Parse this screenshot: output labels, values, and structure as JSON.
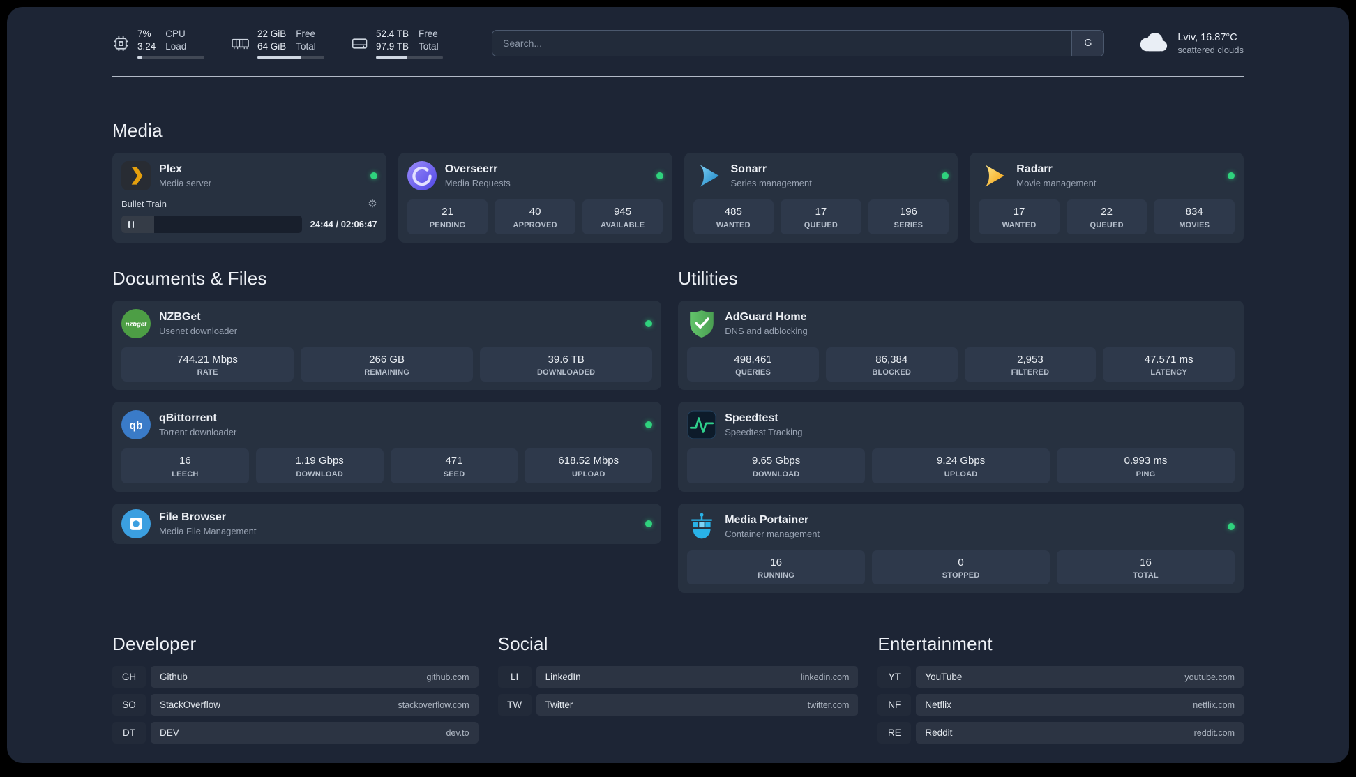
{
  "topbar": {
    "cpu": {
      "percent": "7%",
      "load": "3.24",
      "label_top": "CPU",
      "label_bottom": "Load"
    },
    "memory": {
      "free": "22 GiB",
      "total": "64 GiB",
      "label_top": "Free",
      "label_bottom": "Total"
    },
    "disk": {
      "free": "52.4 TB",
      "total": "97.9 TB",
      "label_top": "Free",
      "label_bottom": "Total"
    },
    "search": {
      "placeholder": "Search...",
      "provider_label": "G"
    },
    "weather": {
      "location": "Lviv, 16.87°C",
      "condition": "scattered clouds"
    }
  },
  "sections": {
    "media": {
      "title": "Media",
      "services": [
        {
          "name": "Plex",
          "desc": "Media server",
          "status": "online",
          "player": {
            "track": "Bullet Train",
            "time": "24:44 / 02:06:47"
          }
        },
        {
          "name": "Overseerr",
          "desc": "Media Requests",
          "status": "online",
          "stats": [
            {
              "value": "21",
              "label": "PENDING"
            },
            {
              "value": "40",
              "label": "APPROVED"
            },
            {
              "value": "945",
              "label": "AVAILABLE"
            }
          ]
        },
        {
          "name": "Sonarr",
          "desc": "Series management",
          "status": "online",
          "stats": [
            {
              "value": "485",
              "label": "WANTED"
            },
            {
              "value": "17",
              "label": "QUEUED"
            },
            {
              "value": "196",
              "label": "SERIES"
            }
          ]
        },
        {
          "name": "Radarr",
          "desc": "Movie management",
          "status": "online",
          "stats": [
            {
              "value": "17",
              "label": "WANTED"
            },
            {
              "value": "22",
              "label": "QUEUED"
            },
            {
              "value": "834",
              "label": "MOVIES"
            }
          ]
        }
      ]
    },
    "documents": {
      "title": "Documents & Files",
      "services": [
        {
          "name": "NZBGet",
          "desc": "Usenet downloader",
          "status": "online",
          "stats": [
            {
              "value": "744.21 Mbps",
              "label": "RATE"
            },
            {
              "value": "266 GB",
              "label": "REMAINING"
            },
            {
              "value": "39.6 TB",
              "label": "DOWNLOADED"
            }
          ]
        },
        {
          "name": "qBittorrent",
          "desc": "Torrent downloader",
          "status": "online",
          "stats": [
            {
              "value": "16",
              "label": "LEECH"
            },
            {
              "value": "1.19 Gbps",
              "label": "DOWNLOAD"
            },
            {
              "value": "471",
              "label": "SEED"
            },
            {
              "value": "618.52 Mbps",
              "label": "UPLOAD"
            }
          ]
        },
        {
          "name": "File Browser",
          "desc": "Media File Management",
          "status": "online"
        }
      ]
    },
    "utilities": {
      "title": "Utilities",
      "services": [
        {
          "name": "AdGuard Home",
          "desc": "DNS and adblocking",
          "stats": [
            {
              "value": "498,461",
              "label": "QUERIES"
            },
            {
              "value": "86,384",
              "label": "BLOCKED"
            },
            {
              "value": "2,953",
              "label": "FILTERED"
            },
            {
              "value": "47.571 ms",
              "label": "LATENCY"
            }
          ]
        },
        {
          "name": "Speedtest",
          "desc": "Speedtest Tracking",
          "stats": [
            {
              "value": "9.65 Gbps",
              "label": "DOWNLOAD"
            },
            {
              "value": "9.24 Gbps",
              "label": "UPLOAD"
            },
            {
              "value": "0.993 ms",
              "label": "PING"
            }
          ]
        },
        {
          "name": "Media Portainer",
          "desc": "Container management",
          "status": "online",
          "stats": [
            {
              "value": "16",
              "label": "RUNNING"
            },
            {
              "value": "0",
              "label": "STOPPED"
            },
            {
              "value": "16",
              "label": "TOTAL"
            }
          ]
        }
      ]
    }
  },
  "bookmark_groups": [
    {
      "title": "Developer",
      "items": [
        {
          "abbr": "GH",
          "name": "Github",
          "url": "github.com"
        },
        {
          "abbr": "SO",
          "name": "StackOverflow",
          "url": "stackoverflow.com"
        },
        {
          "abbr": "DT",
          "name": "DEV",
          "url": "dev.to"
        }
      ]
    },
    {
      "title": "Social",
      "items": [
        {
          "abbr": "LI",
          "name": "LinkedIn",
          "url": "linkedin.com"
        },
        {
          "abbr": "TW",
          "name": "Twitter",
          "url": "twitter.com"
        }
      ]
    },
    {
      "title": "Entertainment",
      "items": [
        {
          "abbr": "YT",
          "name": "YouTube",
          "url": "youtube.com"
        },
        {
          "abbr": "NF",
          "name": "Netflix",
          "url": "netflix.com"
        },
        {
          "abbr": "RE",
          "name": "Reddit",
          "url": "reddit.com"
        }
      ]
    }
  ],
  "colors": {
    "status_online": "#2fd27d",
    "background": "#1d2535",
    "card": "#273140",
    "tile": "#2e394b"
  }
}
